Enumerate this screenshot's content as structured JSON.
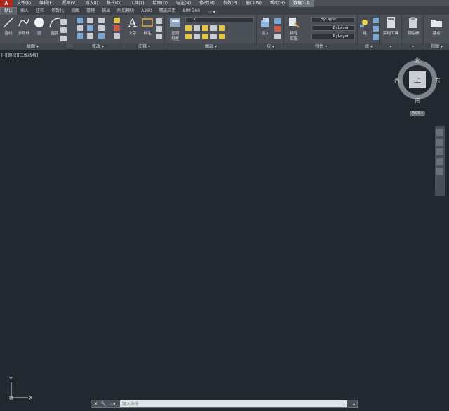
{
  "menu": {
    "logo": "A",
    "items": [
      "文件(F)",
      "编辑(E)",
      "视图(V)",
      "插入(I)",
      "格式(O)",
      "工具(T)",
      "绘图(D)",
      "标注(N)",
      "修改(M)",
      "参数(P)",
      "窗口(W)",
      "帮助(H)",
      "数据工具"
    ]
  },
  "ribbon_tabs": [
    "默认",
    "插入",
    "注释",
    "参数化",
    "视图",
    "管理",
    "输出",
    "附加模块",
    "A360",
    "精选应用",
    "BIM 360"
  ],
  "ribbon_tabs_extra": "▭ ▾",
  "panels": {
    "draw": {
      "title": "绘图 ▾",
      "line": "直线",
      "polyline": "多段线",
      "circle": "圆",
      "arc": "圆弧"
    },
    "modify": {
      "title": "修改 ▾"
    },
    "annotation": {
      "title": "注释 ▾",
      "text": "文字",
      "dimension": "标注"
    },
    "layers": {
      "title": "图层 ▾",
      "layer_props": "图层\n特性",
      "current_layer": "0"
    },
    "block": {
      "title": "块 ▾",
      "insert": "插入"
    },
    "properties": {
      "title": "特性 ▾",
      "match": "特性\n匹配",
      "color": "ByLayer",
      "linetype": "ByLayer",
      "lineweight": "ByLayer"
    },
    "groups": {
      "title": "组 ▾",
      "group": "组"
    },
    "utilities": {
      "title": "▾",
      "measure": "实用工具"
    },
    "clipboard": {
      "title": "▾",
      "paste": "剪贴板"
    },
    "view": {
      "title": "视图 ▾",
      "base": "基点"
    }
  },
  "drawing": {
    "view_label": "[-][俯视][二维线框]",
    "compass": {
      "north": "北",
      "south": "南",
      "east": "东",
      "west": "西"
    },
    "cube_face": "上",
    "wcs": "WCS ▾",
    "ucs_x": "X",
    "ucs_y": "Y"
  },
  "command": {
    "close": "✕",
    "tool": "🔧",
    "prompt_icon": "▭▾",
    "placeholder": "键入命令",
    "scroll": "▴"
  },
  "colors": {
    "canvas": "#212830",
    "ribbon": "#4b5058",
    "accent": "#b3261e"
  }
}
